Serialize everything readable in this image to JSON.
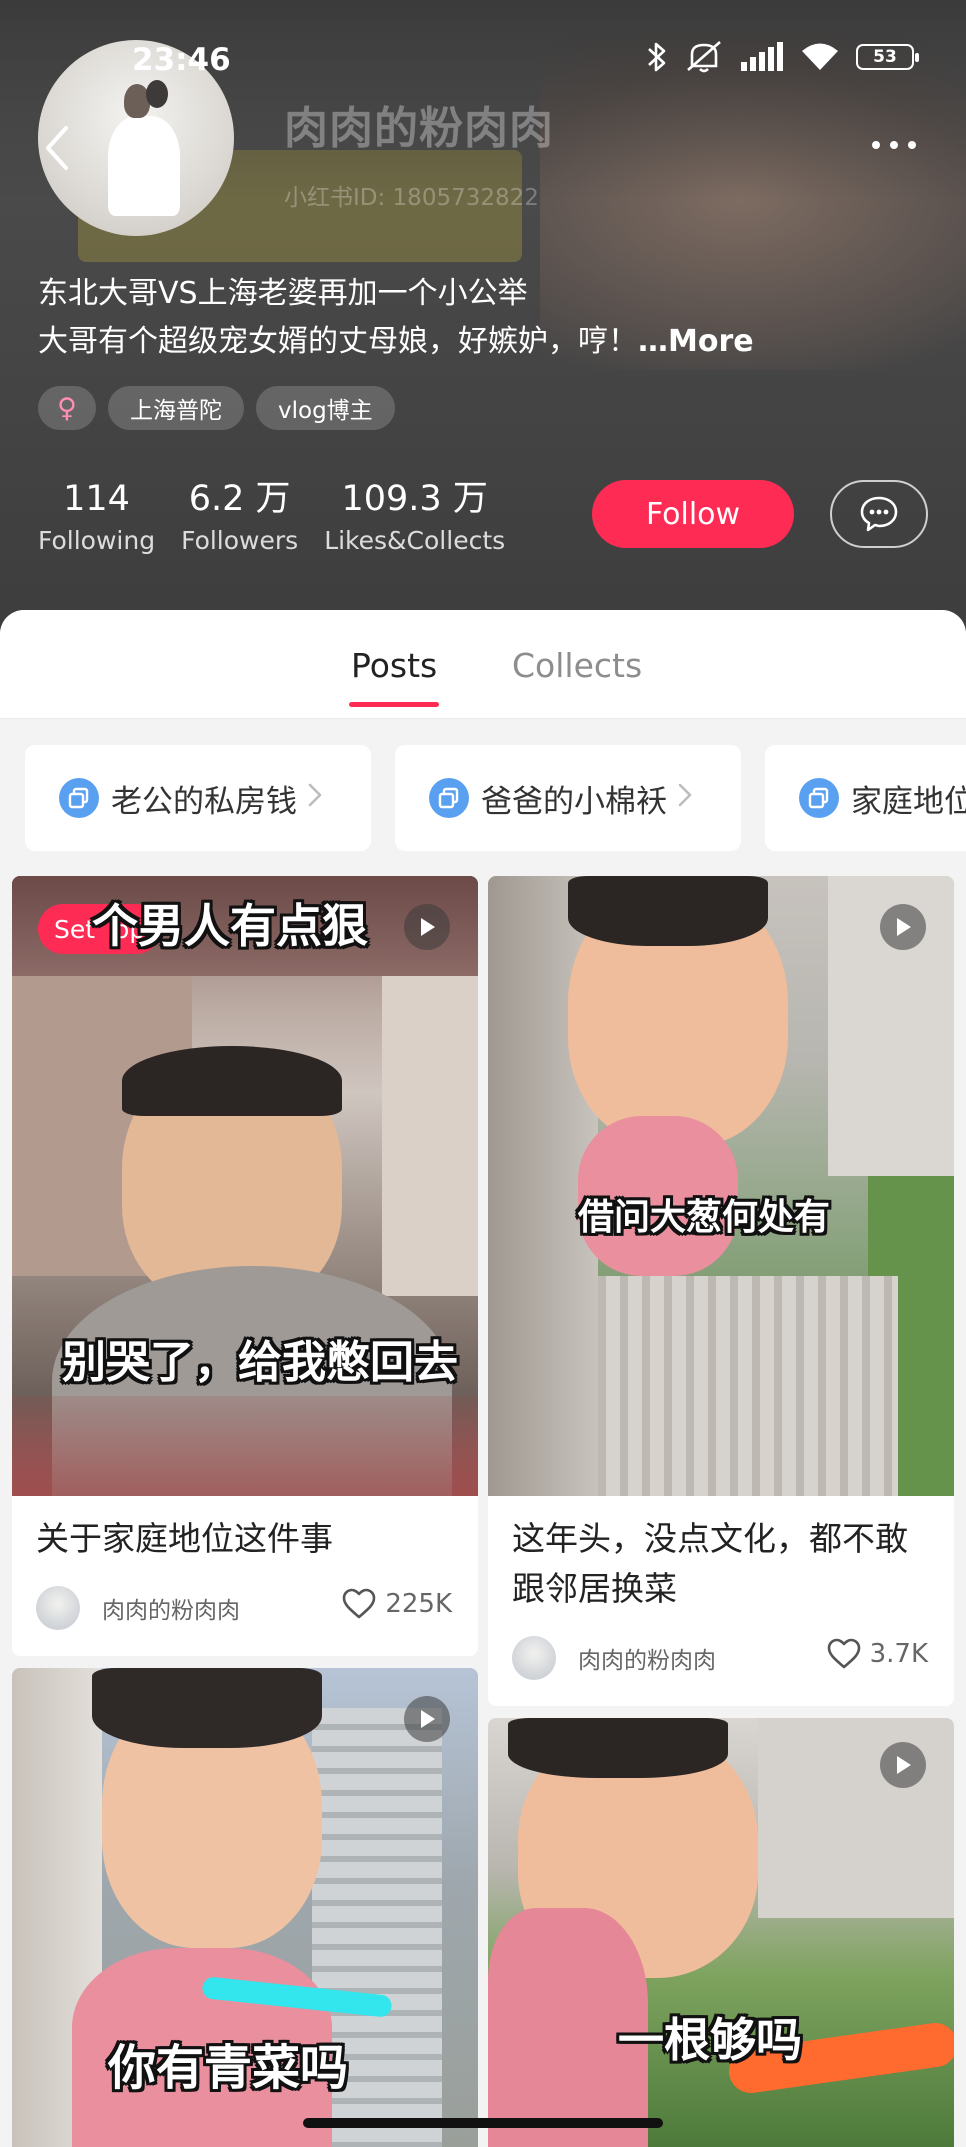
{
  "status_bar": {
    "time": "23:46",
    "battery": "53"
  },
  "profile": {
    "nickname": "肉肉的粉肉肉",
    "user_id": "小红书ID: 1805732822",
    "bio_line1": "东北大哥VS上海老婆再加一个小公举",
    "bio_line2": "大哥有个超级宠女婿的丈母娘，好嫉妒，哼！",
    "more_label": "…More",
    "gender_symbol": "♀",
    "location_tag": "上海普陀",
    "category_tag": "vlog博主",
    "stats": [
      {
        "value": "114",
        "label": "Following"
      },
      {
        "value": "6.2 万",
        "label": "Followers"
      },
      {
        "value": "109.3 万",
        "label": "Likes&Collects"
      }
    ],
    "follow_label": "Follow"
  },
  "tabs": [
    {
      "label": "Posts",
      "active": true
    },
    {
      "label": "Collects",
      "active": false
    }
  ],
  "collections": [
    {
      "label": "老公的私房钱"
    },
    {
      "label": "爸爸的小棉袄"
    },
    {
      "label": "家庭地位"
    }
  ],
  "posts": [
    {
      "badge": "Set Top",
      "caption_top": "个男人有点狠",
      "caption": "别哭了，给我憋回去",
      "title": "关于家庭地位这件事",
      "author": "肉肉的粉肉肉",
      "likes": "225K"
    },
    {
      "caption": "借问大葱何处有",
      "title": "这年头，没点文化，都不敢跟邻居换菜",
      "author": "肉肉的粉肉肉",
      "likes": "3.7K"
    },
    {
      "caption": "你有青菜吗"
    },
    {
      "caption": "一根够吗"
    }
  ],
  "colors": {
    "accent": "#fe2c55",
    "header_bg": "#4a4a4a",
    "collection_icon": "#5aa0f0"
  },
  "icons": [
    "back-icon",
    "more-dots-icon",
    "chat-bubble-icon",
    "bluetooth-icon",
    "mute-icon",
    "signal-icon",
    "wifi-icon",
    "battery-icon",
    "play-icon",
    "heart-icon",
    "chevron-right-icon",
    "collection-icon"
  ]
}
